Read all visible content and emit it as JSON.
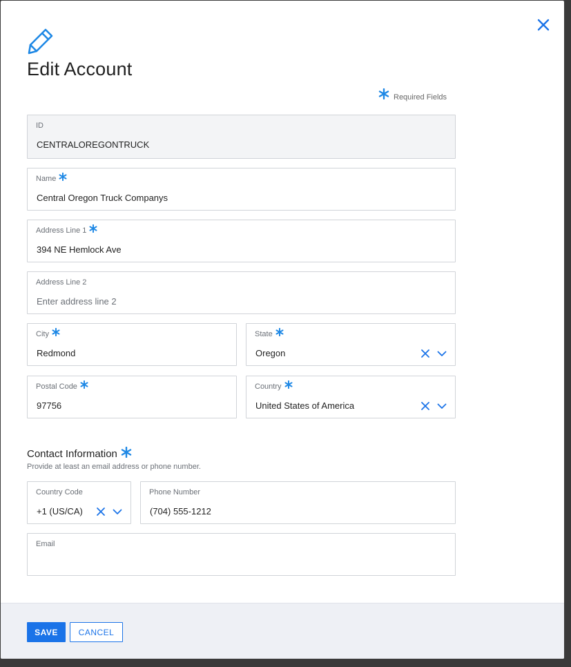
{
  "dialog": {
    "title": "Edit Account",
    "required_note": "Required Fields"
  },
  "fields": {
    "id": {
      "label": "ID",
      "value": "CENTRALOREGONTRUCK"
    },
    "name": {
      "label": "Name",
      "value": "Central Oregon Truck Companys"
    },
    "address1": {
      "label": "Address Line 1",
      "value": "394 NE Hemlock Ave"
    },
    "address2": {
      "label": "Address Line 2",
      "value": "",
      "placeholder": "Enter address line 2"
    },
    "city": {
      "label": "City",
      "value": "Redmond"
    },
    "state": {
      "label": "State",
      "value": "Oregon"
    },
    "postal": {
      "label": "Postal Code",
      "value": "97756"
    },
    "country": {
      "label": "Country",
      "value": "United States of America"
    }
  },
  "contact": {
    "title": "Contact Information",
    "subtitle": "Provide at least an email address or phone number.",
    "country_code": {
      "label": "Country Code",
      "value": "+1 (US/CA)"
    },
    "phone": {
      "label": "Phone Number",
      "value": "(704) 555-1212"
    },
    "email": {
      "label": "Email",
      "value": ""
    }
  },
  "footer": {
    "save_label": "SAVE",
    "cancel_label": "CANCEL"
  },
  "colors": {
    "accent": "#1a73e8",
    "required_star": "#1e88e5"
  }
}
